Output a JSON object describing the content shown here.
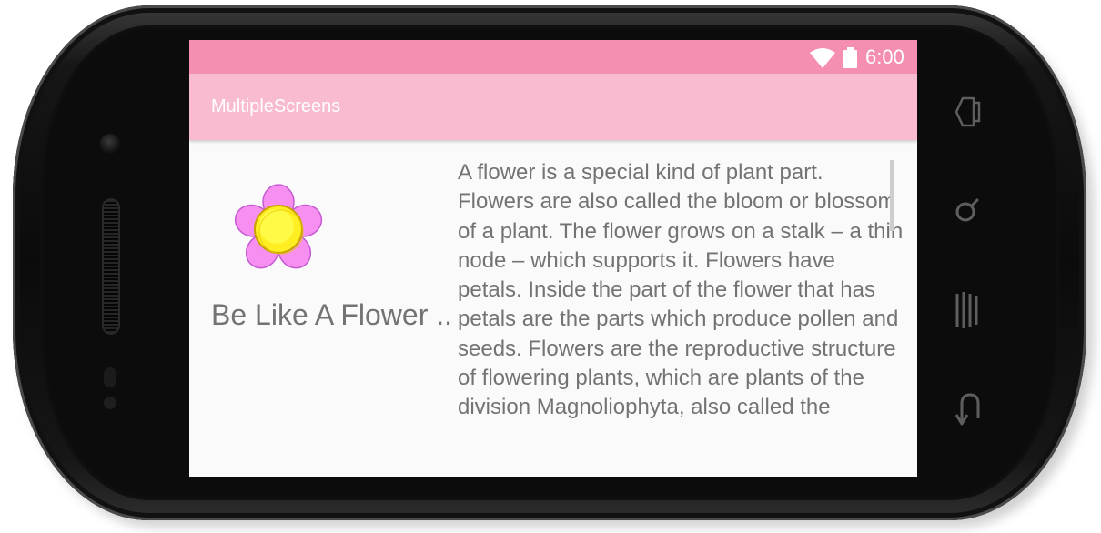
{
  "status_bar": {
    "time": "6:00",
    "icons": [
      "wifi-icon",
      "battery-icon"
    ]
  },
  "app_bar": {
    "title": "MultipleScreens"
  },
  "content": {
    "image_icon": "flower-icon",
    "caption": "Be Like A Flower ..",
    "description": "A flower is a special kind of plant part. Flowers are also called the bloom or blossom of a plant. The flower grows on a stalk – a thin node – which supports it. Flowers have petals. Inside the part of the flower that has petals are the parts which produce pollen and seeds. Flowers are the reproductive structure of flowering plants, which are plants of the division Magnoliophyta, also called the"
  },
  "device_nav": {
    "buttons": [
      "home-icon",
      "search-icon",
      "menu-icon",
      "back-icon"
    ]
  },
  "colors": {
    "status_bar": "#f48fb1",
    "app_bar": "#f8bbd0",
    "screen_background": "#fafafa",
    "text": "#737373",
    "petal": "#f78ff0",
    "flower_center": "#ffee22"
  }
}
